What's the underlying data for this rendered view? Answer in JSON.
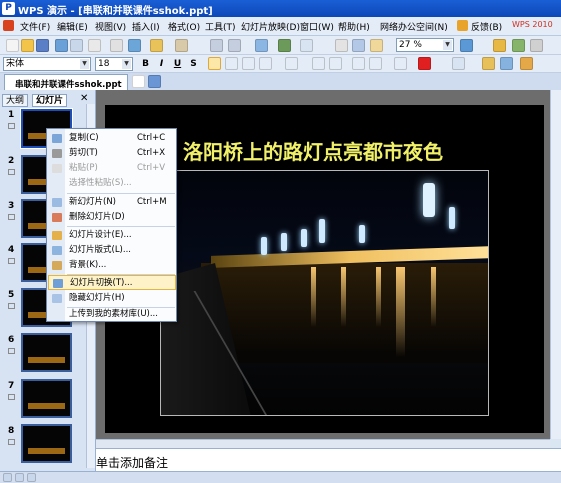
{
  "window": {
    "title": "WPS 演示 - [串联和并联课件sshok.ppt]"
  },
  "menubar": {
    "items": [
      "文件(F)",
      "编辑(E)",
      "视图(V)",
      "插入(I)",
      "格式(O)",
      "工具(T)",
      "幻灯片放映(D)",
      "窗口(W)",
      "帮助(H)",
      "网络办公空间(N)",
      "反馈(B)"
    ],
    "brand": "WPS 2010"
  },
  "toolbar": {
    "zoom": "27 %"
  },
  "format_bar": {
    "font_name": "宋体",
    "font_size": "18",
    "bold": "B",
    "italic": "I",
    "underline": "U",
    "strike": "S"
  },
  "document": {
    "tab_label": "串联和并联课件sshok.ppt"
  },
  "panel": {
    "tabs": [
      "大纲",
      "幻灯片"
    ],
    "slide_numbers": [
      "1",
      "2",
      "3",
      "4",
      "5",
      "6",
      "7",
      "8"
    ]
  },
  "slide": {
    "title": "洛阳桥上的路灯点亮都市夜色"
  },
  "notes": {
    "placeholder": "单击添加备注"
  },
  "context_menu": {
    "items": [
      {
        "label": "复制(C)",
        "shortcut": "Ctrl+C"
      },
      {
        "label": "剪切(T)",
        "shortcut": "Ctrl+X"
      },
      {
        "label": "粘贴(P)",
        "shortcut": "Ctrl+V"
      },
      {
        "label": "选择性粘贴(S)...",
        "shortcut": ""
      },
      {
        "label": "新幻灯片(N)",
        "shortcut": "Ctrl+M"
      },
      {
        "label": "删除幻灯片(D)",
        "shortcut": ""
      },
      {
        "label": "幻灯片设计(E)...",
        "shortcut": ""
      },
      {
        "label": "幻灯片版式(L)...",
        "shortcut": ""
      },
      {
        "label": "背景(K)...",
        "shortcut": ""
      },
      {
        "label": "幻灯片切换(T)...",
        "shortcut": ""
      },
      {
        "label": "隐藏幻灯片(H)",
        "shortcut": ""
      },
      {
        "label": "上传到我的素材库(U)...",
        "shortcut": ""
      }
    ]
  },
  "colors": {
    "titlebar": "#1250c8",
    "slide_title": "#f0f069",
    "menu_highlight": "#fdf2c8"
  }
}
